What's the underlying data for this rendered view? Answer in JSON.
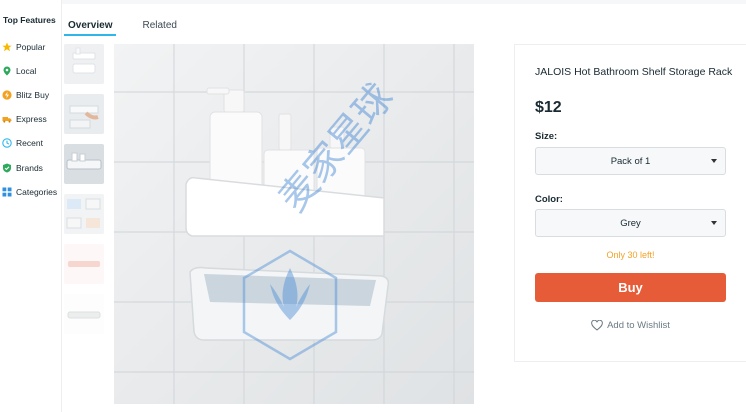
{
  "sidebar": {
    "title": "Top Features",
    "items": [
      {
        "label": "Popular",
        "icon": "star-icon",
        "color": "#f6b800"
      },
      {
        "label": "Local",
        "icon": "pin-icon",
        "color": "#2eaa5c"
      },
      {
        "label": "Blitz Buy",
        "icon": "bolt-icon",
        "color": "#f3a21f"
      },
      {
        "label": "Express",
        "icon": "truck-icon",
        "color": "#f3a21f"
      },
      {
        "label": "Recent",
        "icon": "clock-icon",
        "color": "#2fb7ec"
      },
      {
        "label": "Brands",
        "icon": "shield-check-icon",
        "color": "#2eaa5c"
      },
      {
        "label": "Categories",
        "icon": "grid-icon",
        "color": "#2f8fe0"
      }
    ]
  },
  "tabs": [
    {
      "label": "Overview",
      "active": true
    },
    {
      "label": "Related",
      "active": false
    }
  ],
  "gallery": {
    "thumbnail_count": 7,
    "main_image": "white-bathroom-shelf-rack",
    "watermark_text": "麦家星球"
  },
  "product": {
    "title": "JALOIS Hot Bathroom Shelf Storage Rack",
    "price": "$12",
    "size_label": "Size:",
    "size_value": "Pack of 1",
    "color_label": "Color:",
    "color_value": "Grey",
    "stock_text": "Only 30 left!",
    "buy_label": "Buy",
    "wishlist_label": "Add to Wishlist"
  },
  "colors": {
    "accent": "#2fb7ec",
    "buy": "#e65c38",
    "stock": "#f4a127"
  }
}
